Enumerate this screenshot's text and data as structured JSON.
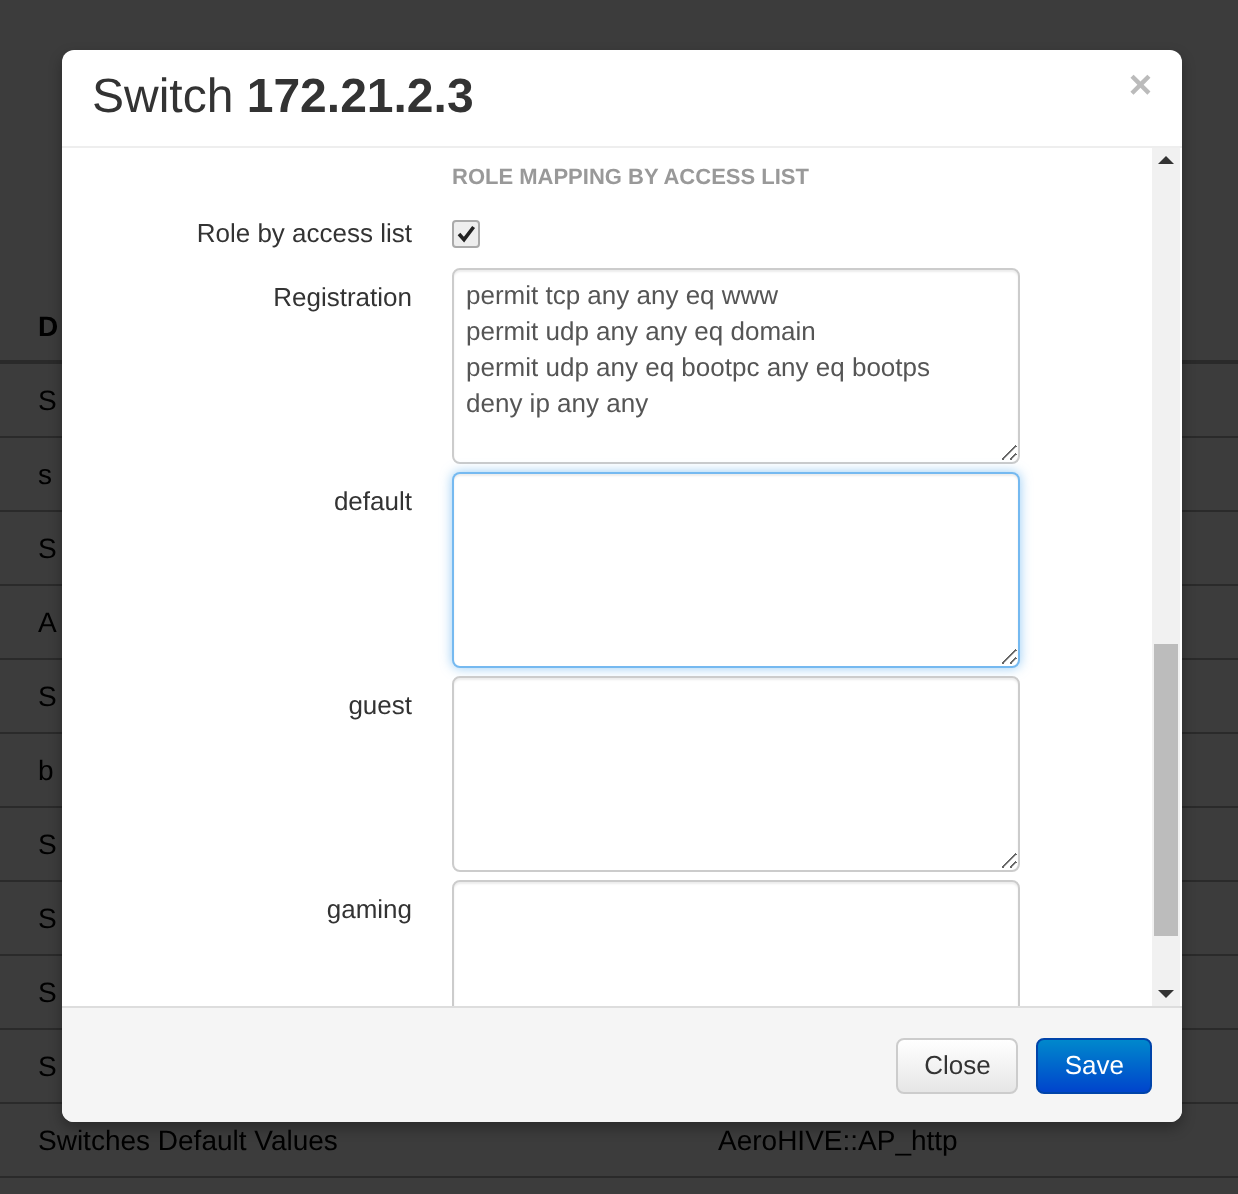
{
  "background_table": {
    "header": "D",
    "rows": [
      {
        "column_1": "S"
      },
      {
        "column_1": "s"
      },
      {
        "column_1": "S"
      },
      {
        "column_1": "A"
      },
      {
        "column_1": "S"
      },
      {
        "column_1": "b"
      },
      {
        "column_1": "S"
      },
      {
        "column_1": "S"
      },
      {
        "column_1": "S"
      },
      {
        "column_1": "S"
      },
      {
        "column_1": "Switches Default Values",
        "column_2": "AeroHIVE::AP_http"
      }
    ]
  },
  "dialog": {
    "title": "Switch **172.21.2.3**",
    "close": "×",
    "section_heading": "ROLE MAPPING BY ACCESS LIST",
    "fields": [
      {
        "kind": "checkbox",
        "label": "Role by access list",
        "checked": true
      },
      {
        "kind": "textarea",
        "label": "Registration",
        "value": "permit tcp any any eq www\npermit udp any any eq domain\npermit udp any eq bootpc any eq bootps\ndeny ip any any",
        "focused": false
      },
      {
        "kind": "textarea",
        "label": "default",
        "focused": true
      },
      {
        "kind": "textarea",
        "label": "guest",
        "focused": false
      },
      {
        "kind": "textarea",
        "label": "gaming",
        "focused": false
      }
    ],
    "buttons": [
      {
        "label": "Close",
        "primary": false
      },
      {
        "label": "Save",
        "primary": true
      }
    ]
  }
}
